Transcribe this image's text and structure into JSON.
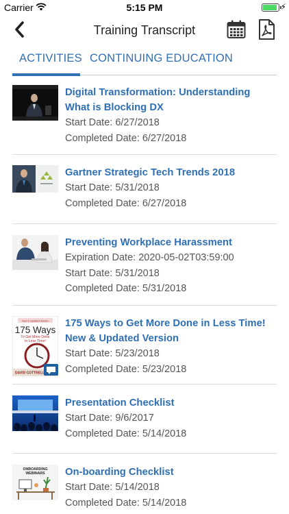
{
  "status_bar": {
    "carrier": "Carrier",
    "time": "5:15 PM"
  },
  "nav": {
    "title": "Training Transcript",
    "back_icon": "chevron-left-icon",
    "calendar_icon": "calendar-icon",
    "pdf_icon": "pdf-icon"
  },
  "tabs": [
    {
      "label": "ACTIVITIES",
      "selected": true
    },
    {
      "label": "CONTINUING EDUCATION",
      "selected": false
    }
  ],
  "activities": [
    {
      "title": "Digital Transformation: Understanding What is Blocking DX",
      "lines": [
        "Start Date: 6/27/2018",
        "Completed Date: 6/27/2018"
      ]
    },
    {
      "title": "Gartner Strategic Tech Trends 2018",
      "lines": [
        "Start Date: 5/31/2018",
        "Completed Date: 6/27/2018"
      ]
    },
    {
      "title": "Preventing Workplace Harassment",
      "lines": [
        "Expiration Date: 2020-05-02T03:59:00",
        "Start Date: 5/31/2018",
        "Completed Date: 5/31/2018"
      ]
    },
    {
      "title": "175 Ways to Get More Done in Less Time! New & Updated Version",
      "lines": [
        "Start Date: 5/23/2018",
        "Completed Date: 5/23/2018"
      ],
      "thumb_text": {
        "top": "New & Updated Version",
        "big": "175 Ways",
        "sub1": "To Get More Done",
        "sub2": "in Less Time!",
        "author": "DAVID COTTRELL"
      }
    },
    {
      "title": "Presentation Checklist",
      "lines": [
        "Start Date: 9/6/2017",
        "Completed Date: 5/14/2018"
      ]
    },
    {
      "title": "On-boarding Checklist",
      "lines": [
        "Start Date: 5/14/2018",
        "Completed Date: 5/14/2018"
      ],
      "thumb_text": {
        "top": "ONBOARDING",
        "sub": "WEBINARS"
      }
    }
  ],
  "colors": {
    "accent": "#2f6fb3",
    "battery": "#4cd964"
  }
}
